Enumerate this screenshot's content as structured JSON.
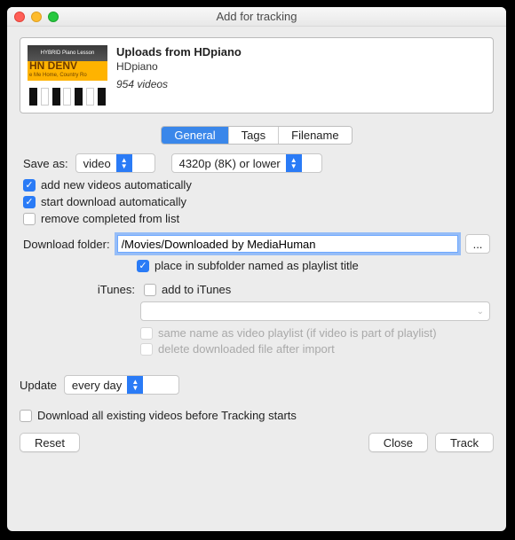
{
  "window": {
    "title": "Add for tracking"
  },
  "source": {
    "title": "Uploads from HDpiano",
    "author": "HDpiano",
    "count_text": "954 videos",
    "thumb_brand_top": "HYBRID Piano Lesson",
    "thumb_brand_mid": "HN DENV",
    "thumb_brand_sub": "e Me Home, Country Ro"
  },
  "tabs": {
    "general": "General",
    "tags": "Tags",
    "filename": "Filename"
  },
  "labels": {
    "save_as": "Save as:",
    "download_folder": "Download folder:",
    "itunes": "iTunes:",
    "update": "Update"
  },
  "selects": {
    "save_as_value": "video",
    "quality_value": "4320p (8K) or lower",
    "update_value": "every day"
  },
  "inputs": {
    "download_folder_value": "/Movies/Downloaded by MediaHuman",
    "itunes_playlist_value": ""
  },
  "checks": {
    "add_new": {
      "label": "add new videos automatically",
      "checked": true
    },
    "start_download": {
      "label": "start download automatically",
      "checked": true
    },
    "remove_completed": {
      "label": "remove completed from list",
      "checked": false
    },
    "subfolder": {
      "label": "place in subfolder named as playlist title",
      "checked": true
    },
    "add_itunes": {
      "label": "add to iTunes",
      "checked": false
    },
    "same_name": {
      "label": "same name as video playlist (if video is part of playlist)",
      "checked": false,
      "disabled": true
    },
    "delete_after": {
      "label": "delete downloaded file after import",
      "checked": false,
      "disabled": true
    },
    "download_existing": {
      "label": "Download all existing videos before Tracking starts",
      "checked": false
    }
  },
  "buttons": {
    "browse": "...",
    "reset": "Reset",
    "close": "Close",
    "track": "Track"
  }
}
